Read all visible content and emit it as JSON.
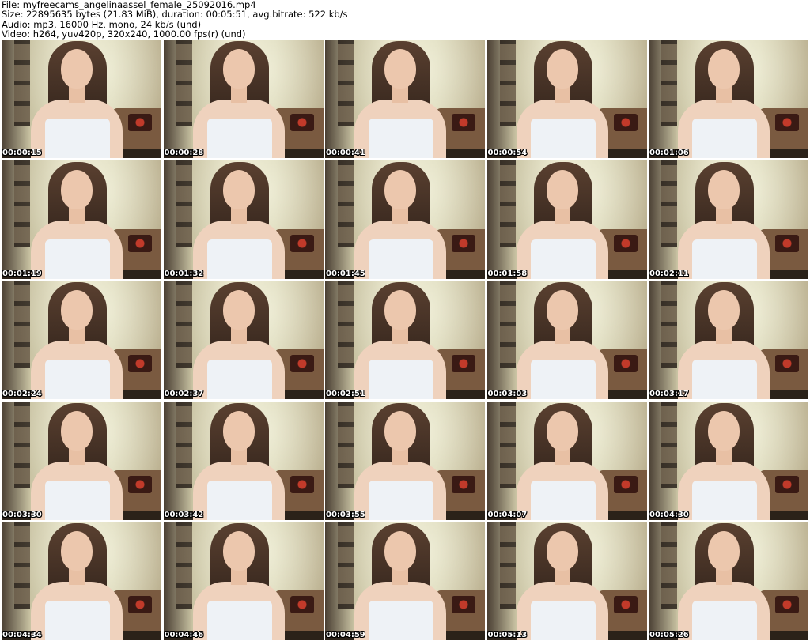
{
  "header": {
    "file_line": "File: myfreecams_angelinaassel_female_25092016.mp4",
    "size_line": "Size: 22895635 bytes (21.83 MiB), duration: 00:05:51, avg.bitrate: 522 kb/s",
    "audio_line": "Audio: mp3, 16000 Hz, mono, 24 kb/s (und)",
    "video_line": "Video: h264, yuv420p, 320x240, 1000.00 fps(r) (und)"
  },
  "thumbnails": [
    {
      "timestamp": "00:00:15"
    },
    {
      "timestamp": "00:00:28"
    },
    {
      "timestamp": "00:00:41"
    },
    {
      "timestamp": "00:00:54"
    },
    {
      "timestamp": "00:01:06"
    },
    {
      "timestamp": "00:01:19"
    },
    {
      "timestamp": "00:01:32"
    },
    {
      "timestamp": "00:01:45"
    },
    {
      "timestamp": "00:01:58"
    },
    {
      "timestamp": "00:02:11"
    },
    {
      "timestamp": "00:02:24"
    },
    {
      "timestamp": "00:02:37"
    },
    {
      "timestamp": "00:02:51"
    },
    {
      "timestamp": "00:03:03"
    },
    {
      "timestamp": "00:03:17"
    },
    {
      "timestamp": "00:03:30"
    },
    {
      "timestamp": "00:03:42"
    },
    {
      "timestamp": "00:03:55"
    },
    {
      "timestamp": "00:04:07"
    },
    {
      "timestamp": "00:04:30"
    },
    {
      "timestamp": "00:04:34"
    },
    {
      "timestamp": "00:04:46"
    },
    {
      "timestamp": "00:04:59"
    },
    {
      "timestamp": "00:05:13"
    },
    {
      "timestamp": "00:05:26"
    }
  ]
}
